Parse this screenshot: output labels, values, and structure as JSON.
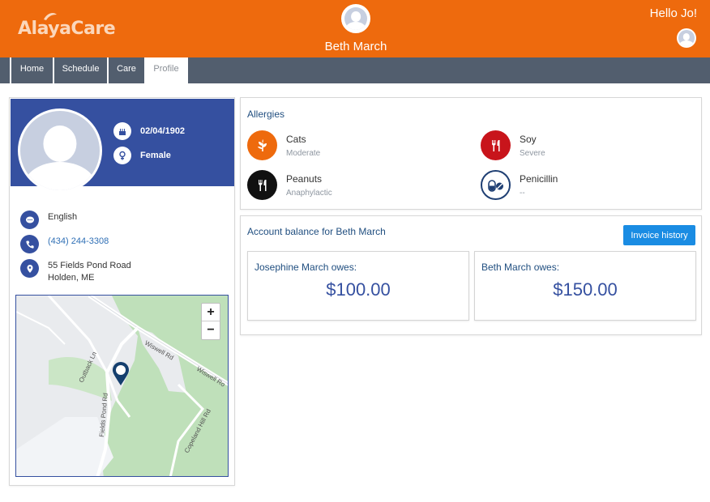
{
  "header": {
    "logo_text": "AlayaCare",
    "patient_name": "Beth March",
    "greeting": "Hello Jo!"
  },
  "nav": {
    "tabs": [
      {
        "label": "Home"
      },
      {
        "label": "Schedule"
      },
      {
        "label": "Care"
      },
      {
        "label": "Profile",
        "active": true
      }
    ]
  },
  "profile": {
    "birthdate": "02/04/1902",
    "gender": "Female",
    "language": "English",
    "phone": "(434) 244-3308",
    "address_line1": "55 Fields Pond Road",
    "address_line2": "Holden, ME"
  },
  "map": {
    "zoom_in": "+",
    "zoom_out": "−",
    "roads": [
      "Wiswell Rd",
      "Outback Ln",
      "Fields Pond Rd",
      "Wiswell Ro",
      "Copeland Hill Rd"
    ]
  },
  "allergies": {
    "title": "Allergies",
    "items": [
      {
        "name": "Cats",
        "severity": "Moderate",
        "color": "#ee6a0d",
        "icon": "leaf-icon"
      },
      {
        "name": "Soy",
        "severity": "Severe",
        "color": "#c8141b",
        "icon": "fork-knife-icon"
      },
      {
        "name": "Peanuts",
        "severity": "Anaphylactic",
        "color": "#111111",
        "icon": "fork-knife-icon"
      },
      {
        "name": "Penicillin",
        "severity": "--",
        "color": "#ffffff",
        "icon": "pill-icon"
      }
    ]
  },
  "balance": {
    "title": "Account balance for Beth March",
    "invoice_button": "Invoice history",
    "owers": [
      {
        "label": "Josephine March owes:",
        "amount": "$100.00"
      },
      {
        "label": "Beth March owes:",
        "amount": "$150.00"
      }
    ]
  },
  "colors": {
    "brand_orange": "#ee6a0d",
    "nav_gray": "#525e6e",
    "profile_blue": "#3550a0",
    "button_blue": "#1a8ce3"
  }
}
